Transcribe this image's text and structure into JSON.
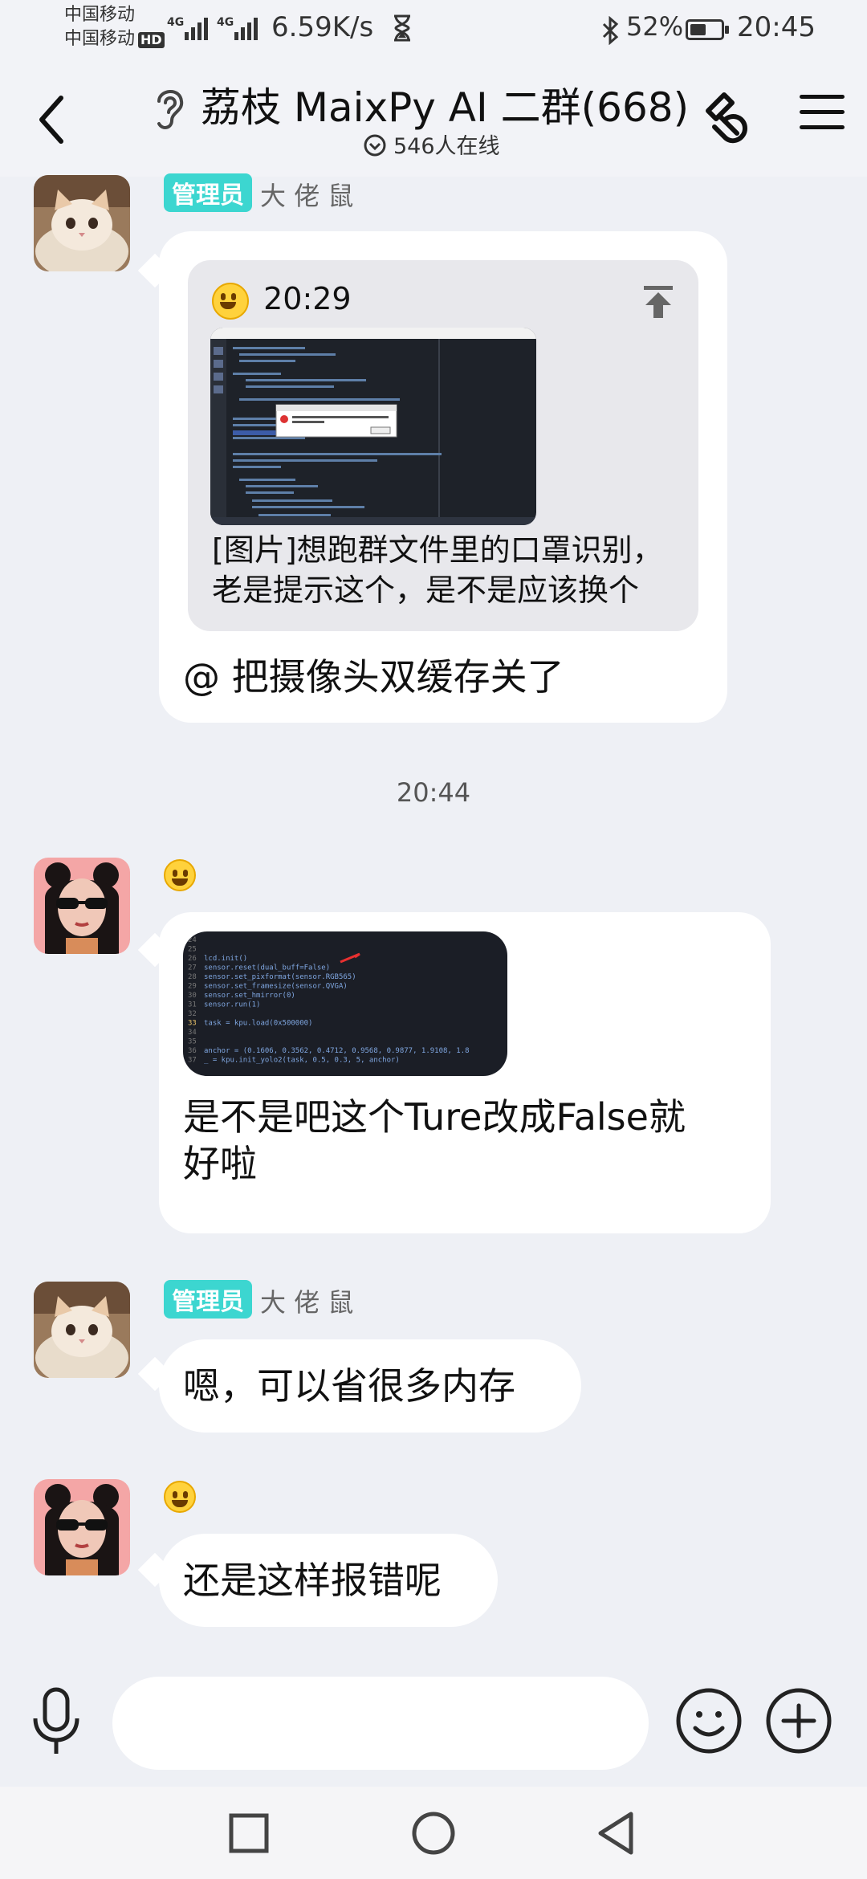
{
  "status_bar": {
    "carrier_1": "中国移动",
    "carrier_2": "中国移动",
    "hd_label": "HD",
    "net_type_1": "4G",
    "net_type_2": "4G",
    "net_speed": "6.59K/s",
    "battery_percent": "52%",
    "battery_level": 0.52,
    "time": "20:45"
  },
  "header": {
    "title": "荔枝 MaixPy AI 二群(668)",
    "online_text": "546人在线",
    "icons": [
      "back-icon",
      "ear-icon",
      "invite-link-icon",
      "menu-icon",
      "chevron-down-circle-icon"
    ]
  },
  "messages": [
    {
      "role": "管理员",
      "sender": "大 佬 鼠",
      "quote_time": "20:29",
      "quote_text_line1": "[图片]想跑群文件里的口罩识别，",
      "quote_text_line2": "老是提示这个，是不是应该换个",
      "text": "@ 把摄像头双缓存关了"
    },
    {
      "time_separator": "20:44"
    },
    {
      "text_line1": "是不是吧这个Ture改成False就",
      "text_line2": "好啦",
      "code_lines": [
        {
          "num": "24",
          "code": ""
        },
        {
          "num": "25",
          "code": ""
        },
        {
          "num": "26",
          "code": "lcd.init()"
        },
        {
          "num": "27",
          "code": "sensor.reset(dual_buff=False)"
        },
        {
          "num": "28",
          "code": "sensor.set_pixformat(sensor.RGB565)"
        },
        {
          "num": "29",
          "code": "sensor.set_framesize(sensor.QVGA)"
        },
        {
          "num": "30",
          "code": "sensor.set_hmirror(0)"
        },
        {
          "num": "31",
          "code": "sensor.run(1)"
        },
        {
          "num": "32",
          "code": ""
        },
        {
          "num": "33",
          "code": "task = kpu.load(0x500000)"
        },
        {
          "num": "34",
          "code": ""
        },
        {
          "num": "35",
          "code": ""
        },
        {
          "num": "36",
          "code": "anchor = (0.1606, 0.3562, 0.4712, 0.9568, 0.9877, 1.9108, 1.8"
        },
        {
          "num": "37",
          "code": "_ = kpu.init_yolo2(task, 0.5, 0.3, 5, anchor)"
        }
      ]
    },
    {
      "role": "管理员",
      "sender": "大 佬 鼠",
      "text": "嗯，可以省很多内存"
    },
    {
      "text": "还是这样报错呢"
    }
  ],
  "input": {
    "placeholder": "",
    "value": ""
  }
}
